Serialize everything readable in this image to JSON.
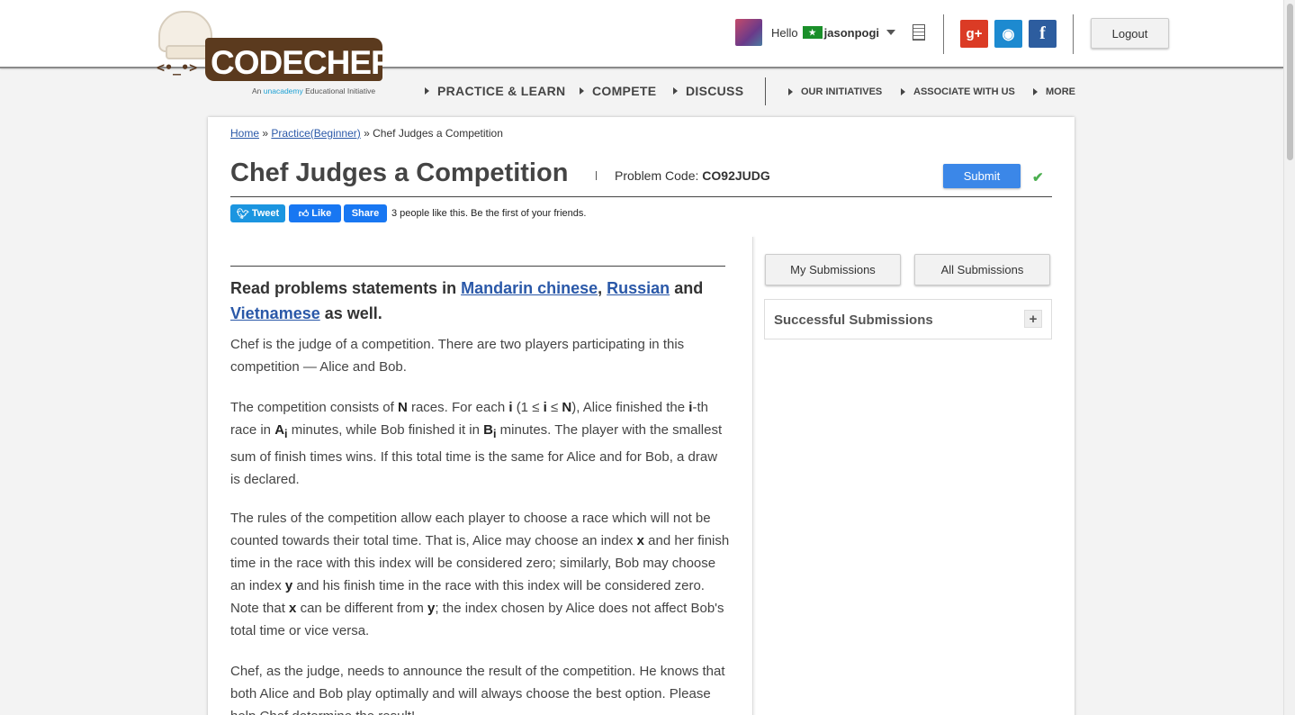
{
  "header": {
    "logo_text": "CODECHEF",
    "logo_tagline_prefix": "An",
    "logo_tagline_brand": "unacademy",
    "logo_tagline_suffix": "Educational Initiative",
    "greeting": "Hello",
    "flag_text": "★",
    "username": "jasonpogi",
    "logout_label": "Logout",
    "social": {
      "gplus": "g+",
      "github": "◉",
      "facebook": "f"
    }
  },
  "nav": {
    "primary": [
      "PRACTICE & LEARN",
      "COMPETE",
      "DISCUSS"
    ],
    "secondary": [
      "OUR INITIATIVES",
      "ASSOCIATE WITH US",
      "MORE"
    ]
  },
  "breadcrumb": {
    "home": "Home",
    "sep": "»",
    "practice": "Practice(Beginner)",
    "current": "Chef Judges a Competition"
  },
  "problem": {
    "title": "Chef Judges a Competition",
    "code_label": "Problem Code:",
    "code": "CO92JUDG",
    "submit_label": "Submit"
  },
  "share": {
    "tweet_label": "Tweet",
    "like_label": "Like",
    "share_label": "Share",
    "likes_text": "3 people like this. Be the first of your friends."
  },
  "statement": {
    "intro_prefix": "Read problems statements in",
    "lang1": "Mandarin chinese",
    "lang2": "Russian",
    "and": "and",
    "lang3": "Vietnamese",
    "intro_suffix": "as well.",
    "p1": "Chef is the judge of a competition. There are two players participating in this competition — Alice and Bob.",
    "p2_a": "The competition consists of",
    "p2_N": "N",
    "p2_b": "races. For each",
    "p2_i": "i",
    "p2_c": "(1 ≤",
    "p2_d": "≤",
    "p2_e": "), Alice finished the",
    "p2_f": "-th race in",
    "p2_A": "A",
    "p2_sub": "i",
    "p2_g": "minutes, while Bob finished it in",
    "p2_B": "B",
    "p2_h": "minutes. The player with the smallest sum of finish times wins. If this total time is the same for Alice and for Bob, a draw is declared.",
    "p3_a": "The rules of the competition allow each player to choose a race which will not be counted towards their total time. That is, Alice may choose an index",
    "p3_x": "x",
    "p3_b": "and her finish time in the race with this index will be considered zero; similarly, Bob may choose an index",
    "p3_y": "y",
    "p3_c": "and his finish time in the race with this index will be considered zero. Note that",
    "p3_d": "can be different from",
    "p3_e": "; the index chosen by Alice does not affect Bob's total time or vice versa.",
    "p4": "Chef, as the judge, needs to announce the result of the competition. He knows that both Alice and Bob play optimally and will always choose the best option. Please help Chef determine the result!"
  },
  "sidebar": {
    "my_submissions": "My Submissions",
    "all_submissions": "All Submissions",
    "successful_title": "Successful Submissions",
    "expand": "+"
  }
}
